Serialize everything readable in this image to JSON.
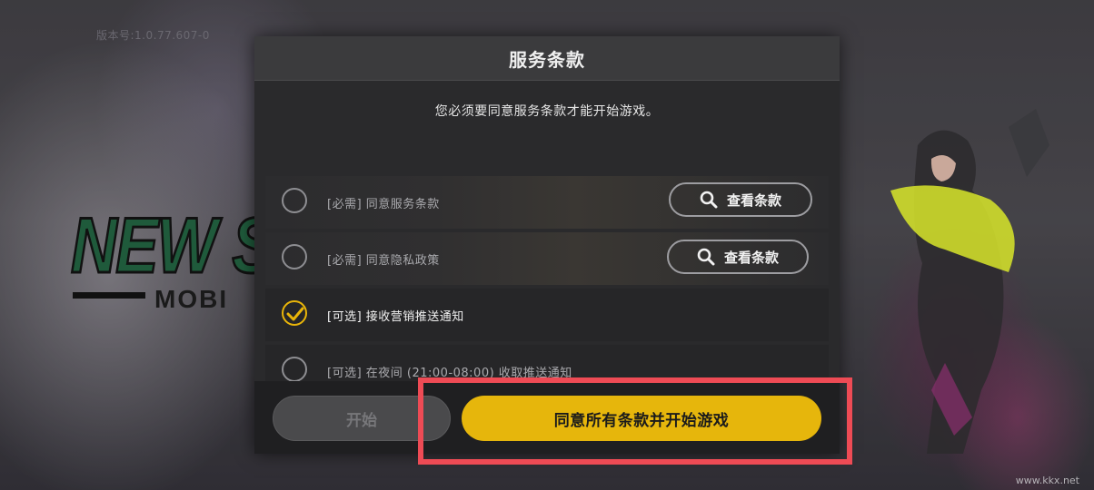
{
  "background": {
    "version_text": "版本号:1.0.77.607-0",
    "logo_main": "NEW S",
    "logo_sub": "MOBI",
    "watermark": "www.kkx.net"
  },
  "modal": {
    "title": "服务条款",
    "subtitle": "您必须要同意服务条款才能开始游戏。",
    "terms": [
      {
        "label": "[必需] 同意服务条款",
        "checked": false,
        "button": "查看条款"
      },
      {
        "label": "[必需] 同意隐私政策",
        "checked": false,
        "button": "查看条款"
      },
      {
        "label": "[可选] 接收营销推送通知",
        "checked": true
      },
      {
        "label": "[可选] 在夜间 (21:00-08:00) 收取推送通知",
        "checked": false
      }
    ],
    "start_button": "开始",
    "agree_all_button": "同意所有条款并开始游戏"
  },
  "colors": {
    "accent": "#e6b60c",
    "highlight": "#ee4b55",
    "modal_bg": "#2a2a2c"
  },
  "icons": {
    "check": "checkmark-icon",
    "search": "magnifier-icon"
  }
}
